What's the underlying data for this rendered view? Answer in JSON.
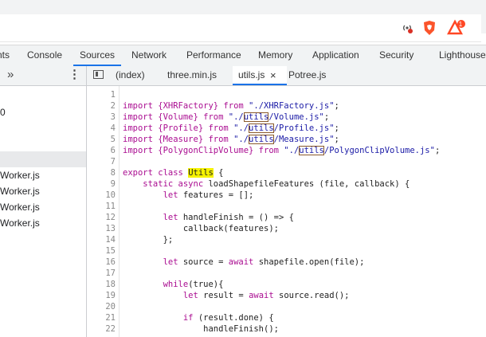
{
  "devtools_tabs": [
    {
      "label": "nts"
    },
    {
      "label": "Console"
    },
    {
      "label": "Sources"
    },
    {
      "label": "Network"
    },
    {
      "label": "Performance"
    },
    {
      "label": "Memory"
    },
    {
      "label": "Application"
    },
    {
      "label": "Security"
    },
    {
      "label": "Lighthouse"
    }
  ],
  "active_devtools_tab": "Sources",
  "more_chevron": "»",
  "menu_dots": "⋮",
  "ext_badge": "1",
  "file_tabs": [
    {
      "label": "(index)"
    },
    {
      "label": "three.min.js"
    },
    {
      "label": "utils.js"
    },
    {
      "label": "Potree.js"
    }
  ],
  "active_file_tab": "utils.js",
  "close_glyph": "×",
  "navigator_items": [
    {
      "label": "0"
    },
    {
      "label": ""
    },
    {
      "label": "Worker.js"
    },
    {
      "label": "Worker.js"
    },
    {
      "label": "Worker.js"
    },
    {
      "label": "Worker.js"
    }
  ],
  "line_numbers": [
    "1",
    "2",
    "3",
    "4",
    "5",
    "6",
    "7",
    "8",
    "9",
    "10",
    "11",
    "12",
    "13",
    "14",
    "15",
    "16",
    "17",
    "18",
    "19",
    "20",
    "21",
    "22"
  ],
  "code": {
    "l2_a": "import {XHRFactory} from ",
    "l2_b": "\"./XHRFactory.js\"",
    "l2_c": ";",
    "l3_a": "import {Volume} from ",
    "l3_b": "\"./",
    "l3_c": "utils",
    "l3_d": "/Volume.js\"",
    "l3_e": ";",
    "l4_a": "import {Profile} from ",
    "l4_b": "\"./",
    "l4_c": "utils",
    "l4_d": "/Profile.js\"",
    "l4_e": ";",
    "l5_a": "import {Measure} from ",
    "l5_b": "\"./",
    "l5_c": "utils",
    "l5_d": "/Measure.js\"",
    "l5_e": ";",
    "l6_a": "import {PolygonClipVolume} from ",
    "l6_b": "\"./",
    "l6_c": "utils",
    "l6_d": "/PolygonClipVolume.js\"",
    "l6_e": ";",
    "l8_a": "export class ",
    "l8_b": "Utils",
    "l8_c": " {",
    "l9_a": "    static async ",
    "l9_b": "loadShapefileFeatures (file, callback) {",
    "l10_a": "        let ",
    "l10_b": "features = [];",
    "l12_a": "        let ",
    "l12_b": "handleFinish = () => {",
    "l13": "            callback(features);",
    "l14": "        };",
    "l16_a": "        let ",
    "l16_b": "source = ",
    "l16_c": "await ",
    "l16_d": "shapefile.open(file);",
    "l18_a": "        while",
    "l18_b": "(true){",
    "l19_a": "            let ",
    "l19_b": "result = ",
    "l19_c": "await ",
    "l19_d": "source.read();",
    "l21_a": "            if ",
    "l21_b": "(result.done) {",
    "l22": "                handleFinish();"
  },
  "colors": {
    "keyword": "#aa0d91",
    "string": "#1a1aa6",
    "search_highlight": "#f5f200",
    "active_tab_underline": "#1a73e8",
    "brave_lion": "#fb542b",
    "bat_triangle": "#ff4724"
  },
  "icons": [
    "broadcast-icon",
    "brave-shield-icon",
    "brave-rewards-icon",
    "toggle-navigator-icon"
  ]
}
